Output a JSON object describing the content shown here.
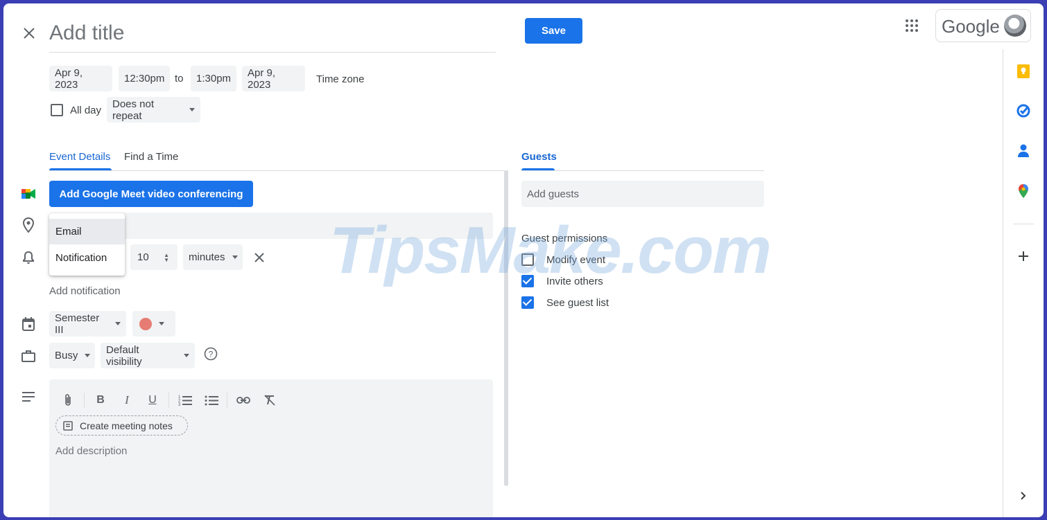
{
  "header": {
    "title_placeholder": "Add title",
    "save_label": "Save",
    "brand": "Google"
  },
  "datetime": {
    "start_date": "Apr 9, 2023",
    "start_time": "12:30pm",
    "to_label": "to",
    "end_time": "1:30pm",
    "end_date": "Apr 9, 2023",
    "timezone_label": "Time zone",
    "all_day_label": "All day",
    "repeat_value": "Does not repeat"
  },
  "tabs": {
    "event_details": "Event Details",
    "find_time": "Find a Time",
    "guests": "Guests"
  },
  "event": {
    "meet_button": "Add Google Meet video conferencing",
    "notification_type_options": [
      "Email",
      "Notification"
    ],
    "notification_amount": "10",
    "notification_unit": "minutes",
    "add_notification": "Add notification",
    "calendar_name": "Semester III",
    "calendar_color": "#e67c73",
    "busy_value": "Busy",
    "visibility_value": "Default visibility",
    "create_notes": "Create meeting notes",
    "description_placeholder": "Add description"
  },
  "guests": {
    "add_placeholder": "Add guests",
    "permissions_title": "Guest permissions",
    "permissions": [
      {
        "label": "Modify event",
        "checked": false
      },
      {
        "label": "Invite others",
        "checked": true
      },
      {
        "label": "See guest list",
        "checked": true
      }
    ]
  },
  "watermark": "TipsMake.com",
  "colors": {
    "accent": "#1a73e8",
    "chip_bg": "#f1f3f4",
    "frame": "#3b3fb3"
  }
}
